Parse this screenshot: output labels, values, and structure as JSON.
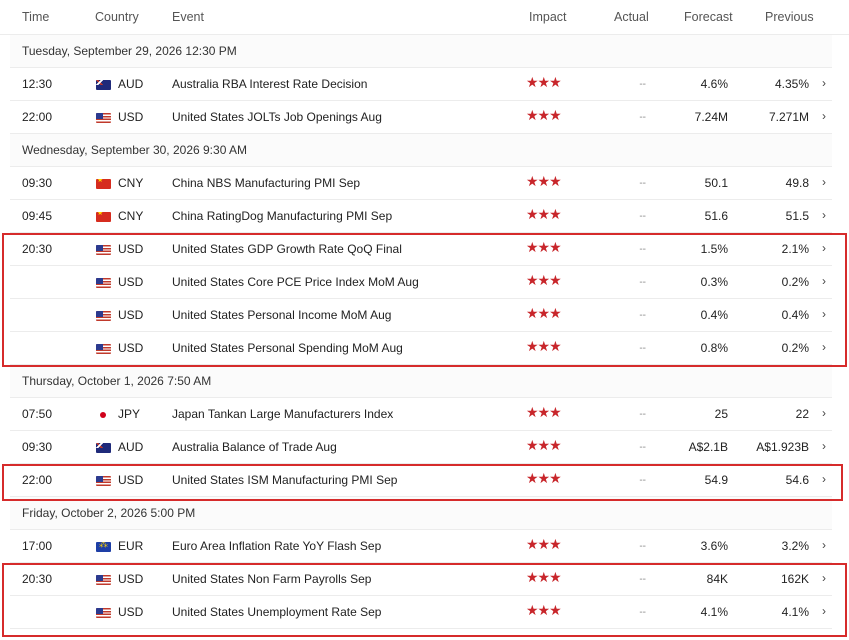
{
  "header": {
    "time": "Time",
    "country": "Country",
    "event": "Event",
    "impact": "Impact",
    "actual": "Actual",
    "forecast": "Forecast",
    "previous": "Previous"
  },
  "dates": [
    "Tuesday, September 29, 2026 12:30 PM",
    "Wednesday, September 30, 2026 9:30 AM",
    "Thursday, October 1, 2026 7:50 AM",
    "Friday, October 2, 2026 5:00 PM"
  ],
  "impact_stars": "★★★",
  "arrow": "›",
  "rows": [
    {
      "time": "12:30",
      "flag": "australia-flag-icon",
      "currency": "AUD",
      "event": "Australia RBA Interest Rate Decision",
      "actual": "--",
      "forecast": "4.6%",
      "previous": "4.35%"
    },
    {
      "time": "22:00",
      "flag": "usa-flag-icon",
      "currency": "USD",
      "event": "United States JOLTs Job Openings Aug",
      "actual": "--",
      "forecast": "7.24M",
      "previous": "7.271M"
    },
    {
      "time": "09:30",
      "flag": "china-flag-icon",
      "currency": "CNY",
      "event": "China NBS Manufacturing PMI Sep",
      "actual": "--",
      "forecast": "50.1",
      "previous": "49.8"
    },
    {
      "time": "09:45",
      "flag": "china-flag-icon",
      "currency": "CNY",
      "event": "China RatingDog Manufacturing PMI Sep",
      "actual": "--",
      "forecast": "51.6",
      "previous": "51.5"
    },
    {
      "time": "20:30",
      "flag": "usa-flag-icon",
      "currency": "USD",
      "event": "United States GDP Growth Rate QoQ Final",
      "actual": "--",
      "forecast": "1.5%",
      "previous": "2.1%"
    },
    {
      "time": "",
      "flag": "usa-flag-icon",
      "currency": "USD",
      "event": "United States Core PCE Price Index MoM Aug",
      "actual": "--",
      "forecast": "0.3%",
      "previous": "0.2%"
    },
    {
      "time": "",
      "flag": "usa-flag-icon",
      "currency": "USD",
      "event": "United States Personal Income MoM Aug",
      "actual": "--",
      "forecast": "0.4%",
      "previous": "0.4%"
    },
    {
      "time": "",
      "flag": "usa-flag-icon",
      "currency": "USD",
      "event": "United States Personal Spending MoM Aug",
      "actual": "--",
      "forecast": "0.8%",
      "previous": "0.2%"
    },
    {
      "time": "07:50",
      "flag": "japan-flag-icon",
      "currency": "JPY",
      "event": "Japan Tankan Large Manufacturers Index",
      "actual": "--",
      "forecast": "25",
      "previous": "22"
    },
    {
      "time": "09:30",
      "flag": "australia-flag-icon",
      "currency": "AUD",
      "event": "Australia Balance of Trade Aug",
      "actual": "--",
      "forecast": "A$2.1B",
      "previous": "A$1.923B"
    },
    {
      "time": "22:00",
      "flag": "usa-flag-icon",
      "currency": "USD",
      "event": "United States ISM Manufacturing PMI Sep",
      "actual": "--",
      "forecast": "54.9",
      "previous": "54.6"
    },
    {
      "time": "17:00",
      "flag": "eu-flag-icon",
      "currency": "EUR",
      "event": "Euro Area Inflation Rate YoY Flash Sep",
      "actual": "--",
      "forecast": "3.6%",
      "previous": "3.2%"
    },
    {
      "time": "20:30",
      "flag": "usa-flag-icon",
      "currency": "USD",
      "event": "United States Non Farm Payrolls Sep",
      "actual": "--",
      "forecast": "84K",
      "previous": "162K"
    },
    {
      "time": "",
      "flag": "usa-flag-icon",
      "currency": "USD",
      "event": "United States Unemployment Rate Sep",
      "actual": "--",
      "forecast": "4.1%",
      "previous": "4.1%"
    }
  ],
  "colors": {
    "highlight": "#d62b2b",
    "impact": "#c8262b"
  }
}
